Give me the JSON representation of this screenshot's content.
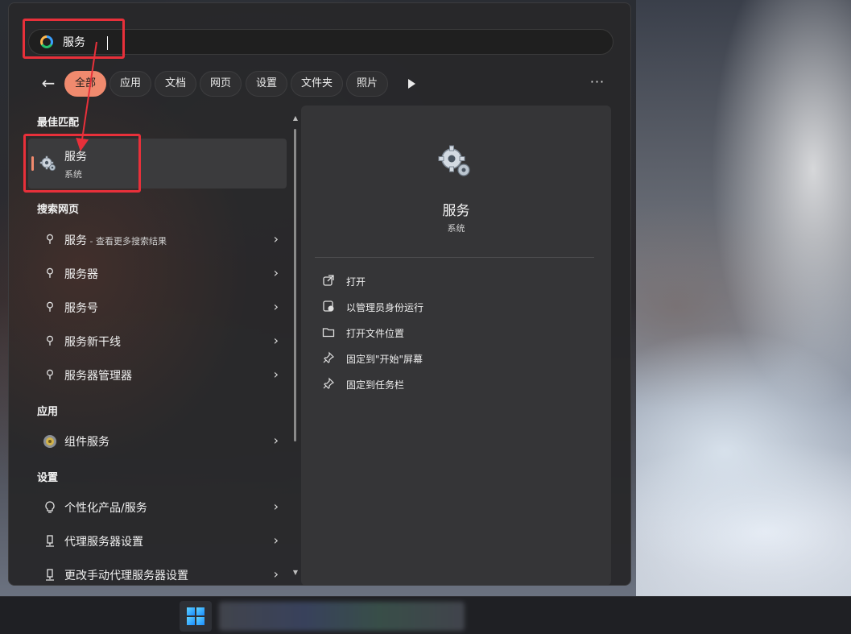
{
  "search": {
    "value": "服务"
  },
  "filters": {
    "chips": [
      "全部",
      "应用",
      "文档",
      "网页",
      "设置",
      "文件夹",
      "照片"
    ],
    "active": "全部",
    "more": "···"
  },
  "best_match": {
    "section": "最佳匹配",
    "title": "服务",
    "subtitle": "系统",
    "icon": "gear-icon"
  },
  "web_search": {
    "section": "搜索网页",
    "items": [
      {
        "label": "服务",
        "suffix": " - 查看更多搜索结果"
      },
      {
        "label": "服务器",
        "suffix": ""
      },
      {
        "label": "服务号",
        "suffix": ""
      },
      {
        "label": "服务新干线",
        "suffix": ""
      },
      {
        "label": "服务器管理器",
        "suffix": ""
      }
    ]
  },
  "apps": {
    "section": "应用",
    "items": [
      {
        "label": "组件服务",
        "icon": "component-services-icon"
      }
    ]
  },
  "settings": {
    "section": "设置",
    "items": [
      {
        "label": "个性化产品/服务",
        "icon": "lightbulb-icon"
      },
      {
        "label": "代理服务器设置",
        "icon": "proxy-icon"
      },
      {
        "label": "更改手动代理服务器设置",
        "icon": "proxy-icon"
      }
    ]
  },
  "detail": {
    "title": "服务",
    "subtitle": "系统",
    "actions": [
      {
        "label": "打开",
        "icon": "open-external-icon"
      },
      {
        "label": "以管理员身份运行",
        "icon": "admin-shield-icon"
      },
      {
        "label": "打开文件位置",
        "icon": "folder-icon"
      },
      {
        "label": "固定到\"开始\"屏幕",
        "icon": "pin-icon"
      },
      {
        "label": "固定到任务栏",
        "icon": "pin-icon"
      }
    ]
  },
  "colors": {
    "accent": "#f08a6e",
    "annotation": "#e8303a"
  }
}
